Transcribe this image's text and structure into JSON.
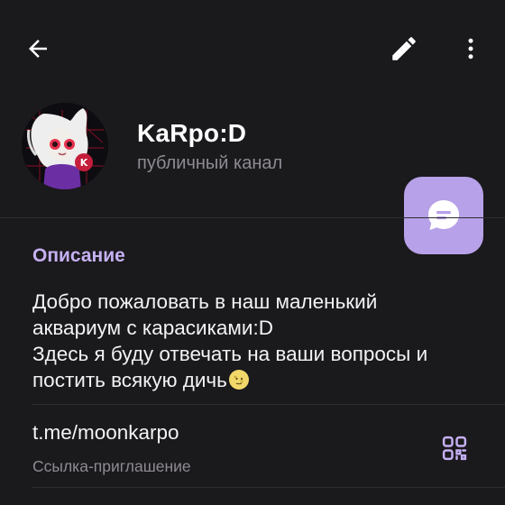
{
  "header": {
    "back_icon": "arrow-left-icon",
    "edit_icon": "pencil-icon",
    "more_icon": "more-vertical-icon"
  },
  "profile": {
    "name": "KaRpo:D",
    "type": "публичный канал",
    "avatar_icon": "channel-avatar",
    "avatar_badge": "K",
    "message_icon": "chat-bubble-icon"
  },
  "info": {
    "description_header": "Описание",
    "description_lines": [
      "Добро пожаловать в наш маленький",
      "аквариум с карасиками:D",
      "Здесь я буду отвечать на ваши вопросы и",
      "постить всякую дичь"
    ],
    "description_emoji": "moon-face-emoji",
    "link": "t.me/moonkarpo",
    "link_subtitle": "Ссылка-приглашение",
    "qr_icon": "qr-code-icon"
  },
  "colors": {
    "background": "#1a191c",
    "accent": "#c5b0f2",
    "fab": "#b7a1e8",
    "secondary_text": "#8e8b93"
  }
}
